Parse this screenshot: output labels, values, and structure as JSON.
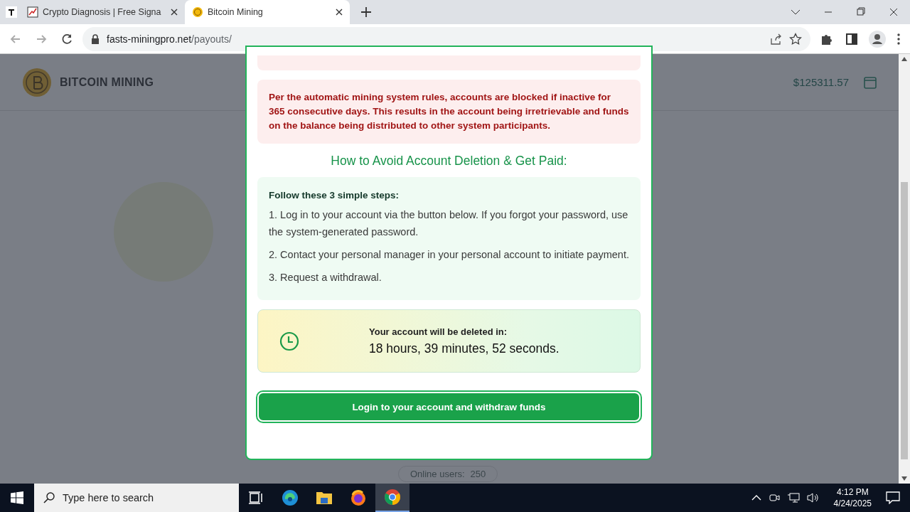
{
  "browser": {
    "tabs": [
      {
        "title": "Crypto Diagnosis | Free Signa",
        "selected": false
      },
      {
        "title": "Bitcoin Mining",
        "selected": true
      }
    ],
    "address": {
      "host": "fasts-miningpro.net",
      "path": "/payouts/"
    }
  },
  "site_header": {
    "brand": "BITCOIN MINING",
    "balance": "$125311.57"
  },
  "modal": {
    "notice": "Per the automatic mining system rules, accounts are blocked if inactive for 365 consecutive days. This results in the account being irretrievable and funds on the balance being distributed to other system participants.",
    "heading": "How to Avoid Account Deletion & Get Paid:",
    "steps_title": "Follow these 3 simple steps:",
    "steps": [
      "1. Log in to your account via the button below. If you forgot your password, use the system-generated password.",
      "2. Contact your personal manager in your personal account to initiate payment.",
      "3. Request a withdrawal."
    ],
    "timer_label": "Your account will be deleted in:",
    "timer_value": "18 hours, 39 minutes, 52 seconds.",
    "button": "Login to your account and withdraw funds"
  },
  "online": {
    "label": "Online users:",
    "count": "250"
  },
  "taskbar": {
    "search_placeholder": "Type here to search",
    "time": "4:12 PM",
    "date": "4/24/2025"
  }
}
